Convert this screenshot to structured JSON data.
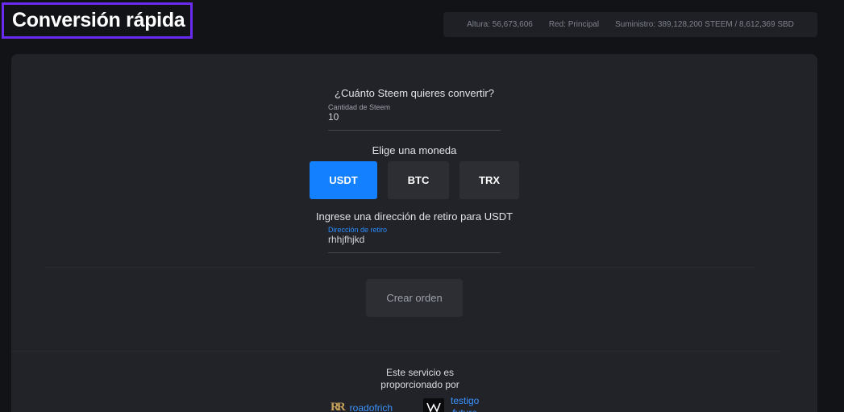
{
  "header": {
    "title": "Conversión rápida",
    "height": "Altura: 56,673,606",
    "network": "Red: Principal",
    "supply": "Suministro: 389,128,200 STEEM / 8,612,369 SBD"
  },
  "form": {
    "amount_question": "¿Cuánto Steem quieres convertir?",
    "amount_label": "Cantidad de Steem",
    "amount_value": "10",
    "currency_question": "Elige una moneda",
    "currencies": [
      "USDT",
      "BTC",
      "TRX"
    ],
    "selected_currency": "USDT",
    "address_question": "Ingrese una dirección de retiro para USDT",
    "address_label": "Dirección de retiro",
    "address_value": "rhhjfhjkd",
    "create_button": "Crear orden"
  },
  "footer": {
    "provided_line1": "Este servicio es",
    "provided_line2": "proporcionado por",
    "provider1_logo": "RR",
    "provider1_name": "roadofrich",
    "provider2_name_line1": "testigo",
    "provider2_name_line2": "future"
  },
  "colors": {
    "accent": "#1380ff",
    "title_border": "#6a2bf0",
    "background": "#121317",
    "card": "#222328"
  }
}
